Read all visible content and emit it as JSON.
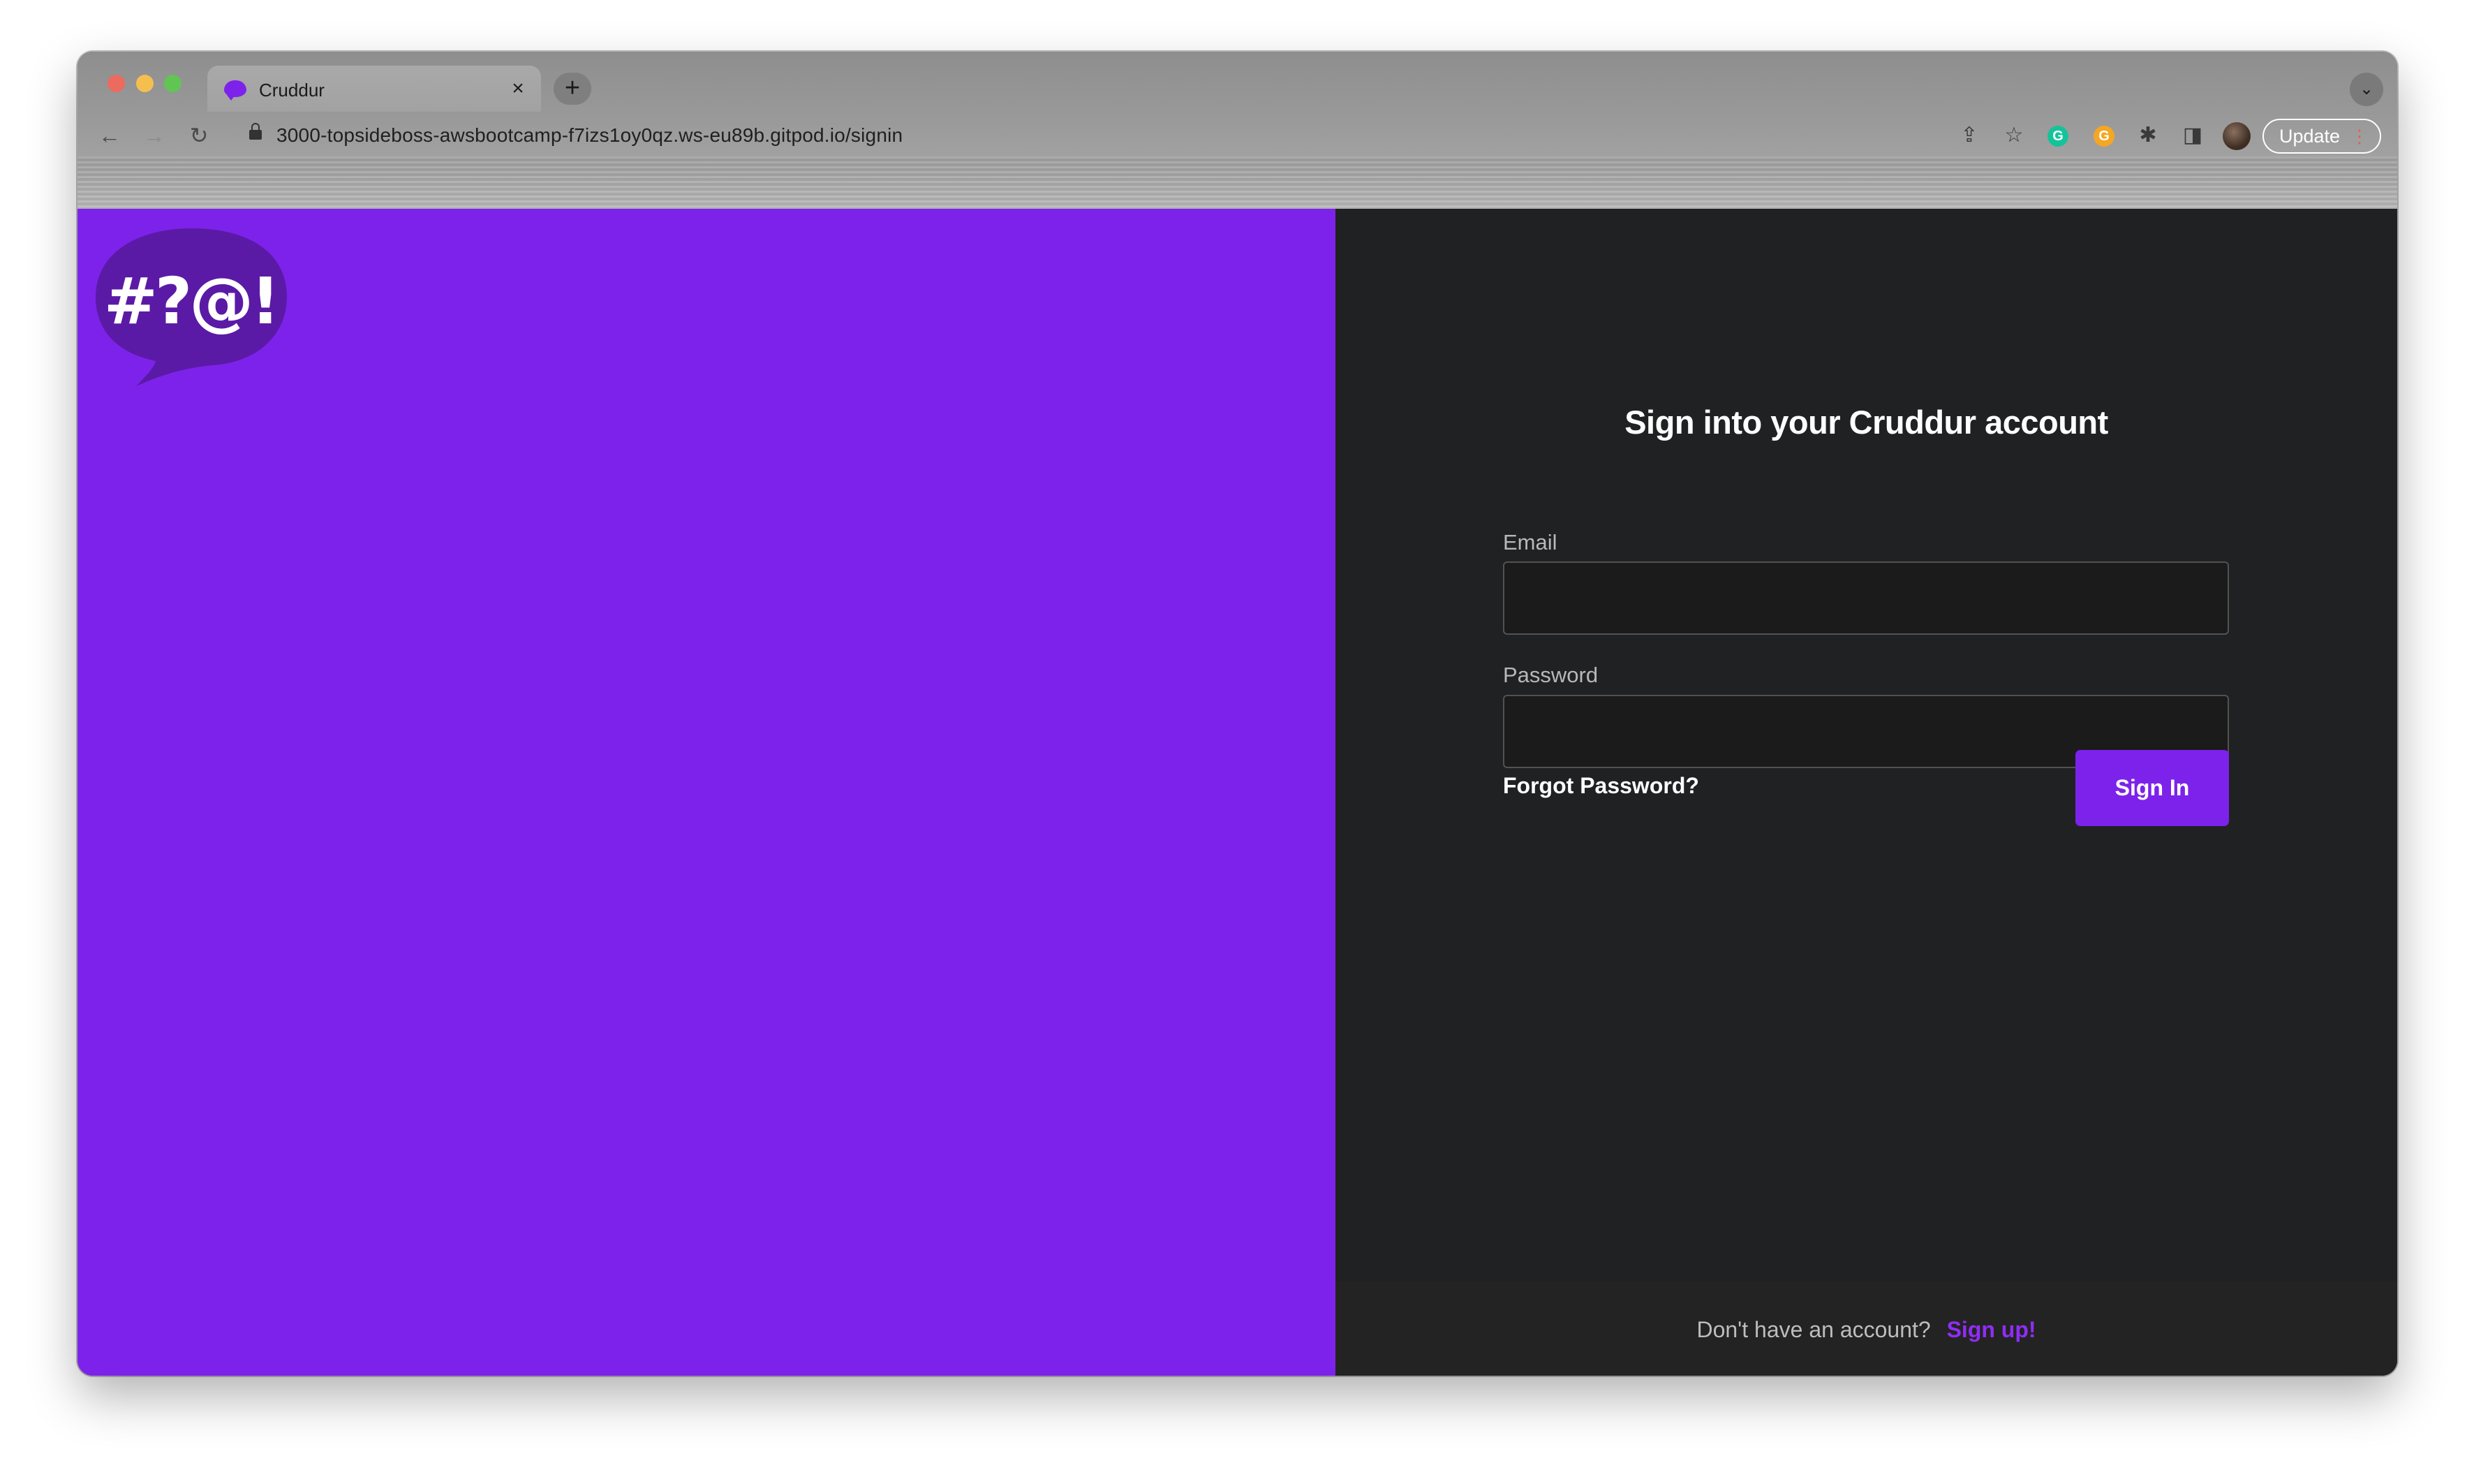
{
  "browser": {
    "tab_title": "Cruddur",
    "tab_close": "×",
    "new_tab": "+",
    "url": "3000-topsideboss-awsbootcamp-f7izs1oy0qz.ws-eu89b.gitpod.io/signin",
    "update_label": "Update",
    "update_dots": "⋮",
    "nav": {
      "back": "←",
      "forward": "→",
      "reload": "↻"
    },
    "tools": {
      "share": "⇪",
      "star": "☆",
      "puzzle": "✱",
      "sidebar": "◨",
      "tab_search": "⌄"
    },
    "extensions": {
      "grammarly": "G",
      "orange": "G"
    }
  },
  "logo": {
    "text": "#?@!",
    "color": "#5b1aa6"
  },
  "signin": {
    "title": "Sign into your Cruddur account",
    "email_label": "Email",
    "email_value": "",
    "password_label": "Password",
    "password_value": "",
    "forgot_label": "Forgot Password?",
    "submit_label": "Sign In"
  },
  "footer": {
    "text": "Don't have an account?",
    "signup_label": "Sign up!"
  },
  "colors": {
    "accent": "#7d22eb",
    "panel_dark": "#202123",
    "signup_link": "#8f2df5"
  }
}
